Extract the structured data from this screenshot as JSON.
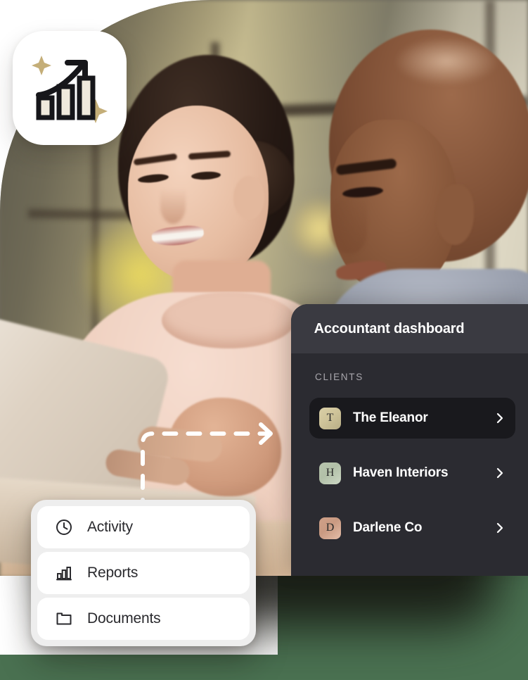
{
  "badge": {
    "icon": "growth-bar-chart-icon",
    "sparkle_color": "#c4ae78",
    "bar_color": "#16161a"
  },
  "dashboard": {
    "title": "Accountant dashboard",
    "section_label": "CLIENTS",
    "header_bg": "#3a3a41",
    "body_bg": "#2b2b31",
    "active_row_bg": "#19191d",
    "clients": [
      {
        "initial": "T",
        "name": "The Eleanor",
        "avatar_color": "#cfc49a",
        "active": true,
        "chevron": "chevron-right-icon"
      },
      {
        "initial": "H",
        "name": "Haven Interiors",
        "avatar_color": "#b2c0a8",
        "active": false,
        "chevron": "chevron-right-icon"
      },
      {
        "initial": "D",
        "name": "Darlene Co",
        "avatar_color": "#c99a82",
        "active": false,
        "chevron": "chevron-right-icon"
      }
    ]
  },
  "menu": {
    "items": [
      {
        "label": "Activity",
        "icon": "clock-icon"
      },
      {
        "label": "Reports",
        "icon": "bar-chart-icon"
      },
      {
        "label": "Documents",
        "icon": "folder-icon"
      }
    ]
  },
  "connector": {
    "icon": "dashed-arrow-icon",
    "color": "#ffffff"
  },
  "colors": {
    "page_background": "#4a7151",
    "card_background": "#ffffff",
    "menu_tray": "#eeeeee"
  }
}
